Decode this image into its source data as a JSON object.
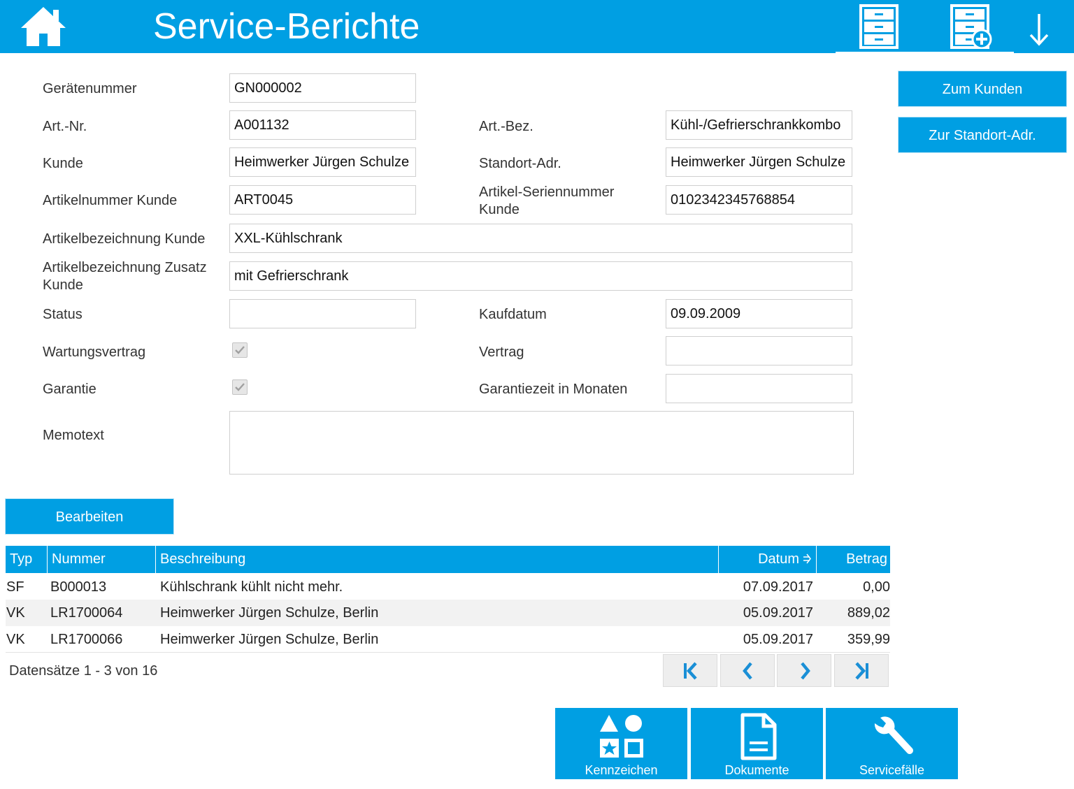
{
  "header": {
    "title": "Service-Berichte",
    "icons": [
      "home-icon",
      "file-cabinet-icon",
      "file-cabinet-add-icon",
      "arrow-down-icon"
    ]
  },
  "form": {
    "geraetenummer": {
      "label": "Gerätenummer",
      "value": "GN000002"
    },
    "artnr": {
      "label": "Art.-Nr.",
      "value": "A001132"
    },
    "artbez": {
      "label": "Art.-Bez.",
      "value": "Kühl-/Gefrierschrankkombo"
    },
    "kunde": {
      "label": "Kunde",
      "value": "Heimwerker Jürgen Schulze"
    },
    "standort": {
      "label": "Standort-Adr.",
      "value": "Heimwerker Jürgen Schulze"
    },
    "artnr_kunde": {
      "label": "Artikelnummer Kunde",
      "value": "ART0045"
    },
    "serien_kunde": {
      "label_line1": "Artikel-Seriennummer",
      "label_line2": "Kunde",
      "value": "0102342345768854"
    },
    "artbez_kunde": {
      "label": "Artikelbezeichnung Kunde",
      "value": "XXL-Kühlschrank"
    },
    "zusatz_kunde": {
      "label_line1": "Artikelbezeichnung Zusatz",
      "label_line2": "Kunde",
      "value": "mit Gefrierschrank"
    },
    "status": {
      "label": "Status",
      "value": ""
    },
    "kaufdatum": {
      "label": "Kaufdatum",
      "value": "09.09.2009"
    },
    "wartungsvertrag": {
      "label": "Wartungsvertrag",
      "checked": true
    },
    "vertrag": {
      "label": "Vertrag",
      "value": ""
    },
    "garantie": {
      "label": "Garantie",
      "checked": true
    },
    "garantiezeit": {
      "label": "Garantiezeit in Monaten",
      "value": ""
    },
    "memotext": {
      "label": "Memotext",
      "value": ""
    }
  },
  "side_buttons": {
    "zum_kunden": "Zum Kunden",
    "zur_standort": "Zur Standort-Adr."
  },
  "edit_button": "Bearbeiten",
  "grid": {
    "columns": [
      "Typ",
      "Nummer",
      "Beschreibung",
      "Datum",
      "Betrag"
    ],
    "rows": [
      {
        "typ": "SF",
        "nummer": "B000013",
        "beschreibung": "Kühlschrank kühlt nicht mehr.",
        "datum": "07.09.2017",
        "betrag": "0,00"
      },
      {
        "typ": "VK",
        "nummer": "LR1700064",
        "beschreibung": "Heimwerker Jürgen Schulze, Berlin",
        "datum": "05.09.2017",
        "betrag": "889,02"
      },
      {
        "typ": "VK",
        "nummer": "LR1700066",
        "beschreibung": "Heimwerker Jürgen Schulze, Berlin",
        "datum": "05.09.2017",
        "betrag": "359,99"
      }
    ],
    "pager_text": "Datensätze 1 - 3 von 16"
  },
  "tiles": {
    "kennzeichen": "Kennzeichen",
    "dokumente": "Dokumente",
    "servicefaelle": "Servicefälle"
  },
  "colors": {
    "accent": "#009fe3",
    "row_alt": "#f2f2f2"
  }
}
